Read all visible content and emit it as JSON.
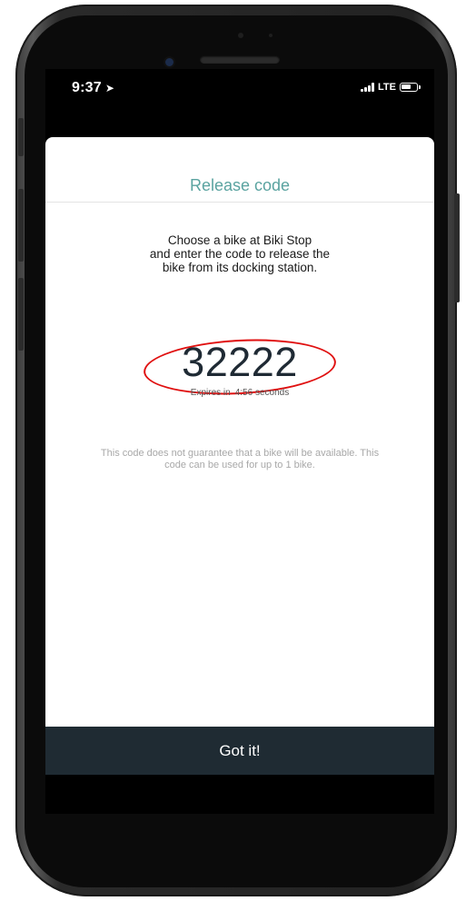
{
  "status_bar": {
    "time": "9:37",
    "location_icon": "location-arrow-icon",
    "network": "LTE",
    "signal_icon": "cellular-signal-icon",
    "battery_icon": "battery-icon"
  },
  "sheet": {
    "title": "Release code",
    "instructions": "Choose a bike at Biki Stop\nand enter the code to release the\nbike from its docking station.",
    "code": "32222",
    "expires_label": "Expires in",
    "expires_value": "4:56 seconds",
    "disclaimer": "This code does not guarantee that a bike will be available. This code can be used for up to 1 bike.",
    "confirm_label": "Got it!"
  },
  "colors": {
    "title_teal": "#5aa3a0",
    "button_dark": "#1f2b33",
    "highlight_red": "#e01010"
  }
}
